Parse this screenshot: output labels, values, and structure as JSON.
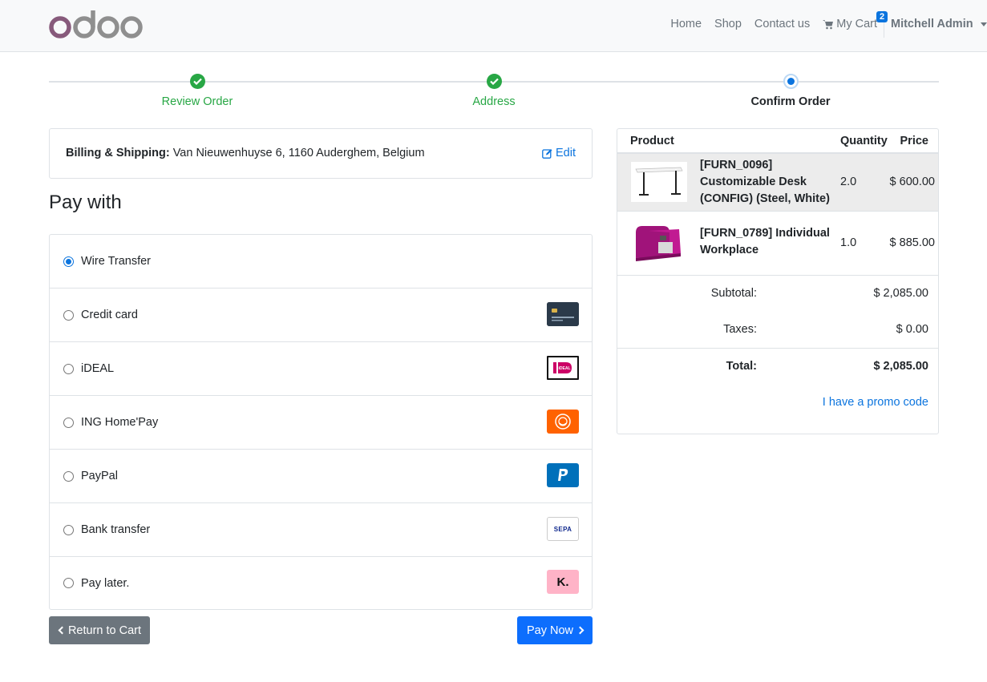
{
  "header": {
    "logo_text": "odoo",
    "nav": [
      "Home",
      "Shop",
      "Contact us"
    ],
    "cart_label": "My Cart",
    "cart_count": "2",
    "user_name": "Mitchell Admin"
  },
  "wizard": {
    "steps": [
      {
        "label": "Review Order",
        "state": "done"
      },
      {
        "label": "Address",
        "state": "done"
      },
      {
        "label": "Confirm Order",
        "state": "current"
      }
    ]
  },
  "billing": {
    "label": "Billing & Shipping:",
    "address": "Van Nieuwenhuyse 6, 1160 Auderghem, Belgium",
    "edit_label": "Edit"
  },
  "payment": {
    "title": "Pay with",
    "selected": "Wire Transfer",
    "methods": [
      {
        "label": "Wire Transfer",
        "logo": ""
      },
      {
        "label": "Credit card",
        "logo": "credit-card-logo"
      },
      {
        "label": "iDEAL",
        "logo": "ideal-logo"
      },
      {
        "label": "ING Home'Pay",
        "logo": "ing-lion-logo"
      },
      {
        "label": "PayPal",
        "logo": "paypal-logo"
      },
      {
        "label": "Bank transfer",
        "logo": "sepa-logo"
      },
      {
        "label": "Pay later.",
        "logo": "klarna-logo"
      }
    ],
    "sepa_text": "SEPA",
    "klarna_text": "K.",
    "ideal_text": "iDEAL"
  },
  "buttons": {
    "return_label": "Return to Cart",
    "pay_label": "Pay Now"
  },
  "summary": {
    "headers": {
      "product": "Product",
      "quantity": "Quantity",
      "price": "Price"
    },
    "items": [
      {
        "name": "[FURN_0096] Customizable Desk (CONFIG) (Steel, White)",
        "qty": "2.0",
        "price": "$ 600.00"
      },
      {
        "name": "[FURN_0789] Individual Workplace",
        "qty": "1.0",
        "price": "$ 885.00"
      }
    ],
    "subtotal_label": "Subtotal:",
    "subtotal": "$ 2,085.00",
    "taxes_label": "Taxes:",
    "taxes": "$ 0.00",
    "total_label": "Total:",
    "total": "$ 2,085.00",
    "promo_label": "I have a promo code"
  },
  "colors": {
    "accent": "#0b74de",
    "success": "#28a745",
    "secondary": "#6c757d",
    "brand_purple": "#875a7b"
  }
}
